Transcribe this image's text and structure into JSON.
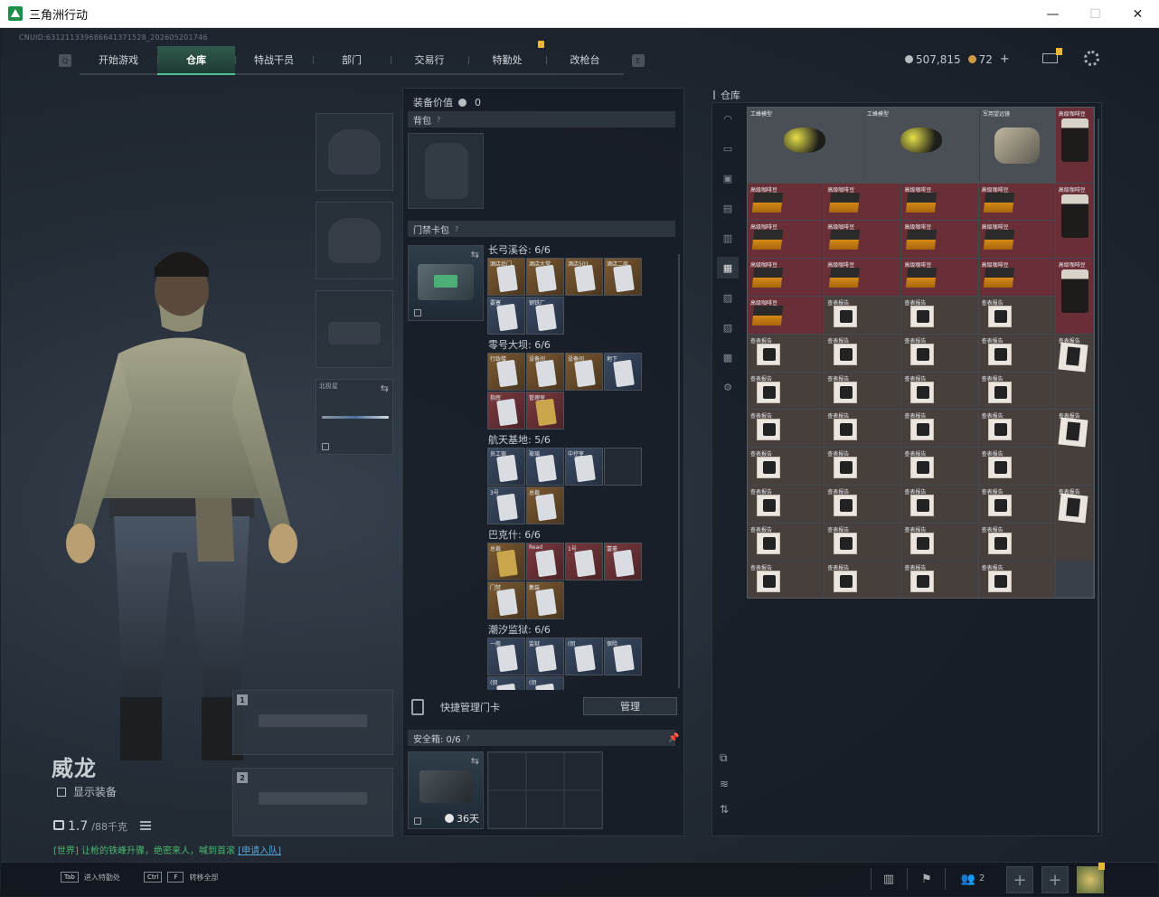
{
  "window": {
    "title": "三角洲行动",
    "minimize": "—",
    "maximize": "☐",
    "close": "✕"
  },
  "uid": "CNUID:631211339686641371528_202605201746",
  "nav": {
    "tabs": [
      "开始游戏",
      "仓库",
      "特战干员",
      "部门",
      "交易行",
      "特勤处",
      "改枪台"
    ],
    "active": "仓库",
    "left_key": "Q",
    "right_key": "E"
  },
  "currency": {
    "coins": "507,815",
    "gold": "72",
    "plus": "+"
  },
  "character": {
    "name": "威龙",
    "show_equipment": "显示装备",
    "weight": "1.7",
    "weight_max": "/88千克",
    "chat_prefix": "[世界]",
    "chat_text": "让枪的铁峰升骤，绝密来人，喊到首滚",
    "chat_link": "[申请入队]"
  },
  "slots": {
    "melee_label": "北极星",
    "weapon_1": "1",
    "weapon_2": "2"
  },
  "middle": {
    "equip_value_label": "装备价值",
    "equip_value": "0",
    "backpack": "背包",
    "keycard_pack": "门禁卡包",
    "groups": [
      {
        "title": "长弓溪谷: 6/6",
        "labels": [
          "酒店后门",
          "酒店大堂",
          "酒店501",
          "酒店二层",
          "要塞",
          "钢铁厂"
        ]
      },
      {
        "title": "零号大坝: 6/6",
        "labels": [
          "行政楼",
          "设备间",
          "设备间",
          "地下",
          "指挥",
          "管理室"
        ]
      },
      {
        "title": "航天基地: 5/6",
        "labels": [
          "员工宿",
          "玻璃",
          "中控室",
          "",
          "3号",
          "总裁"
        ]
      },
      {
        "title": "巴克什: 6/6",
        "labels": [
          "总裁",
          "Read",
          "1号",
          "富豪",
          "门禁",
          "集装"
        ]
      },
      {
        "title": "潮汐监狱: 6/6",
        "labels": [
          "一般",
          "监狱",
          "(钥",
          "保险",
          "(钥",
          "(钥"
        ]
      }
    ],
    "quick_manage": "快捷管理门卡",
    "manage_button": "管理",
    "safe_box": "安全箱: 0/6",
    "safe_timer": "36天"
  },
  "warehouse": {
    "title": "仓库",
    "items": {
      "wasp": "工蜂模型",
      "binoculars": "军用望远镜",
      "coffee": "高级咖啡豆",
      "coffee_bag": "高级咖啡豆",
      "paper": "查表报告",
      "paper_alt": "查表报告"
    }
  },
  "bottom": {
    "hint1_key": "Tab",
    "hint1": "进入特勤处",
    "hint2_key_a": "Ctrl",
    "hint2_key_b": "F",
    "hint2": "转移全部",
    "team_count": "2"
  }
}
